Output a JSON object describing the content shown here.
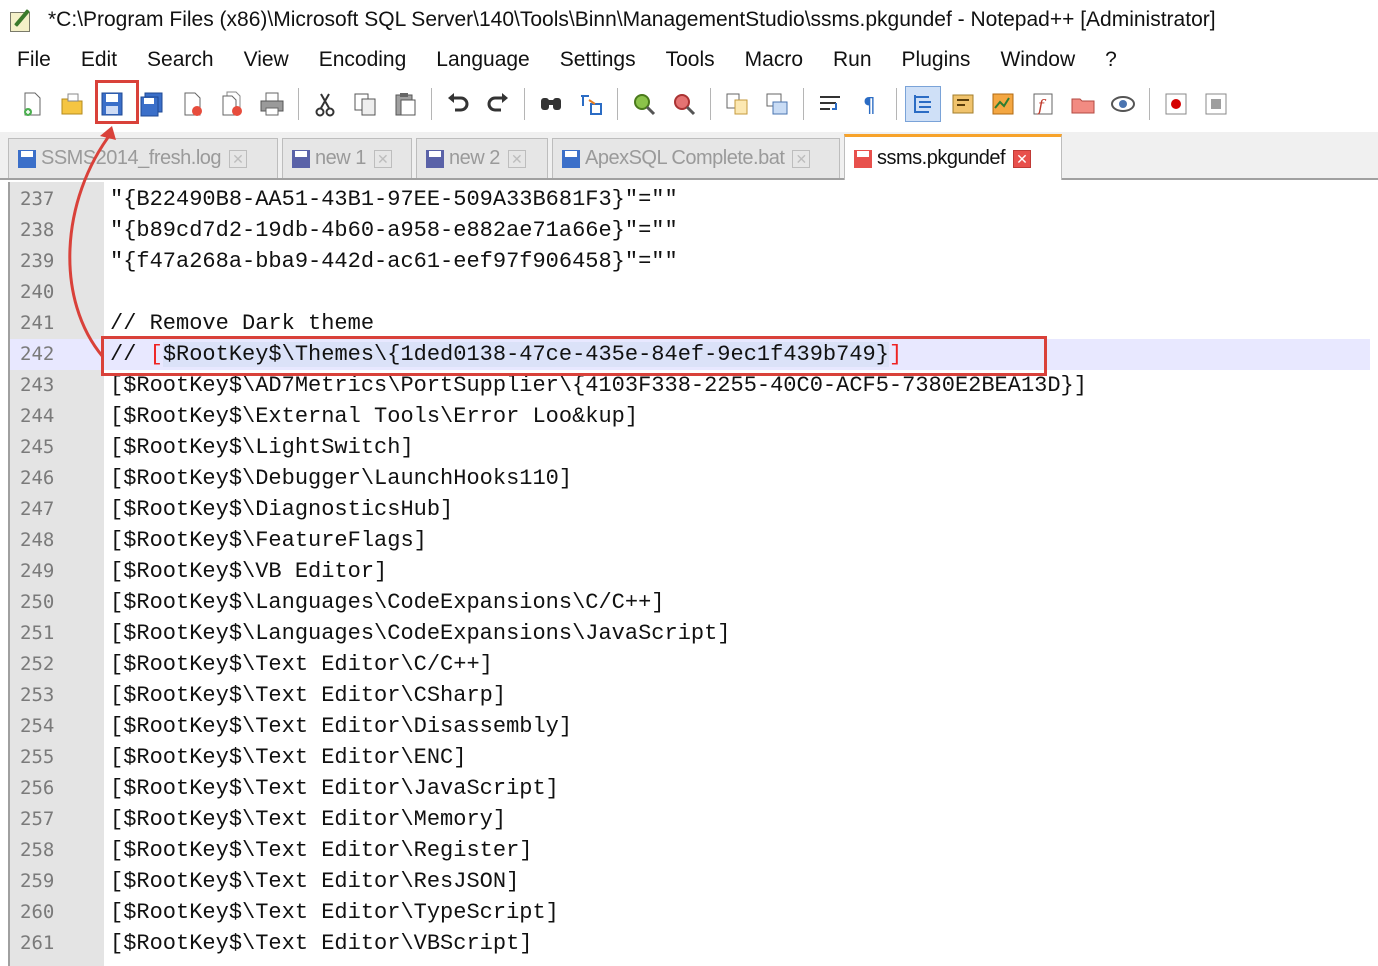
{
  "window": {
    "title": "*C:\\Program Files (x86)\\Microsoft SQL Server\\140\\Tools\\Binn\\ManagementStudio\\ssms.pkgundef - Notepad++ [Administrator]"
  },
  "menu": {
    "items": [
      "File",
      "Edit",
      "Search",
      "View",
      "Encoding",
      "Language",
      "Settings",
      "Tools",
      "Macro",
      "Run",
      "Plugins",
      "Window",
      "?"
    ]
  },
  "toolbar": {
    "icons": [
      "new-file-icon",
      "open-file-icon",
      "save-icon",
      "save-all-icon",
      "close-icon",
      "close-all-icon",
      "print-icon",
      "cut-icon",
      "copy-icon",
      "paste-icon",
      "undo-icon",
      "redo-icon",
      "find-icon",
      "replace-icon",
      "zoom-in-icon",
      "zoom-out-icon",
      "sync-vertical-icon",
      "sync-horizontal-icon",
      "word-wrap-icon",
      "show-all-chars-icon",
      "indent-guide-icon",
      "user-language-icon",
      "doc-map-icon",
      "function-list-icon",
      "folder-workspace-icon",
      "monitoring-icon",
      "record-macro-icon",
      "stop-macro-icon"
    ]
  },
  "tabs": [
    {
      "label": "SSMS2014_fresh.log",
      "close": "✕"
    },
    {
      "label": "new 1",
      "close": "✕"
    },
    {
      "label": "new 2",
      "close": "✕"
    },
    {
      "label": "ApexSQL Complete.bat",
      "close": "✕"
    },
    {
      "label": "ssms.pkgundef",
      "close": "✕"
    }
  ],
  "editor": {
    "lines": [
      {
        "num": "237",
        "text": "\"{B22490B8-AA51-43B1-97EE-509A33B681F3}\"=\"\""
      },
      {
        "num": "238",
        "text": "\"{b89cd7d2-19db-4b60-a958-e882ae71a66e}\"=\"\""
      },
      {
        "num": "239",
        "text": "\"{f47a268a-bba9-442d-ac61-eef97f906458}\"=\"\""
      },
      {
        "num": "240",
        "text": ""
      },
      {
        "num": "241",
        "text": "// Remove Dark theme"
      },
      {
        "num": "242",
        "prefix": "// ",
        "bracket_open": "[",
        "text": "$RootKey$\\Themes\\{1ded0138-47ce-435e-84ef-9ec1f439b749}",
        "bracket_close": "]"
      },
      {
        "num": "243",
        "text": "[$RootKey$\\AD7Metrics\\PortSupplier\\{4103F338-2255-40C0-ACF5-7380E2BEA13D}]"
      },
      {
        "num": "244",
        "text": "[$RootKey$\\External Tools\\Error Loo&kup]"
      },
      {
        "num": "245",
        "text": "[$RootKey$\\LightSwitch]"
      },
      {
        "num": "246",
        "text": "[$RootKey$\\Debugger\\LaunchHooks110]"
      },
      {
        "num": "247",
        "text": "[$RootKey$\\DiagnosticsHub]"
      },
      {
        "num": "248",
        "text": "[$RootKey$\\FeatureFlags]"
      },
      {
        "num": "249",
        "text": "[$RootKey$\\VB Editor]"
      },
      {
        "num": "250",
        "text": "[$RootKey$\\Languages\\CodeExpansions\\C/C++]"
      },
      {
        "num": "251",
        "text": "[$RootKey$\\Languages\\CodeExpansions\\JavaScript]"
      },
      {
        "num": "252",
        "text": "[$RootKey$\\Text Editor\\C/C++]"
      },
      {
        "num": "253",
        "text": "[$RootKey$\\Text Editor\\CSharp]"
      },
      {
        "num": "254",
        "text": "[$RootKey$\\Text Editor\\Disassembly]"
      },
      {
        "num": "255",
        "text": "[$RootKey$\\Text Editor\\ENC]"
      },
      {
        "num": "256",
        "text": "[$RootKey$\\Text Editor\\JavaScript]"
      },
      {
        "num": "257",
        "text": "[$RootKey$\\Text Editor\\Memory]"
      },
      {
        "num": "258",
        "text": "[$RootKey$\\Text Editor\\Register]"
      },
      {
        "num": "259",
        "text": "[$RootKey$\\Text Editor\\ResJSON]"
      },
      {
        "num": "260",
        "text": "[$RootKey$\\Text Editor\\TypeScript]"
      },
      {
        "num": "261",
        "text": "[$RootKey$\\Text Editor\\VBScript]"
      }
    ]
  },
  "colors": {
    "annotation": "#d9413a",
    "active_tab_accent": "#f7a32b",
    "current_line": "#e8e8ff",
    "gutter": "#e4e4e4"
  }
}
